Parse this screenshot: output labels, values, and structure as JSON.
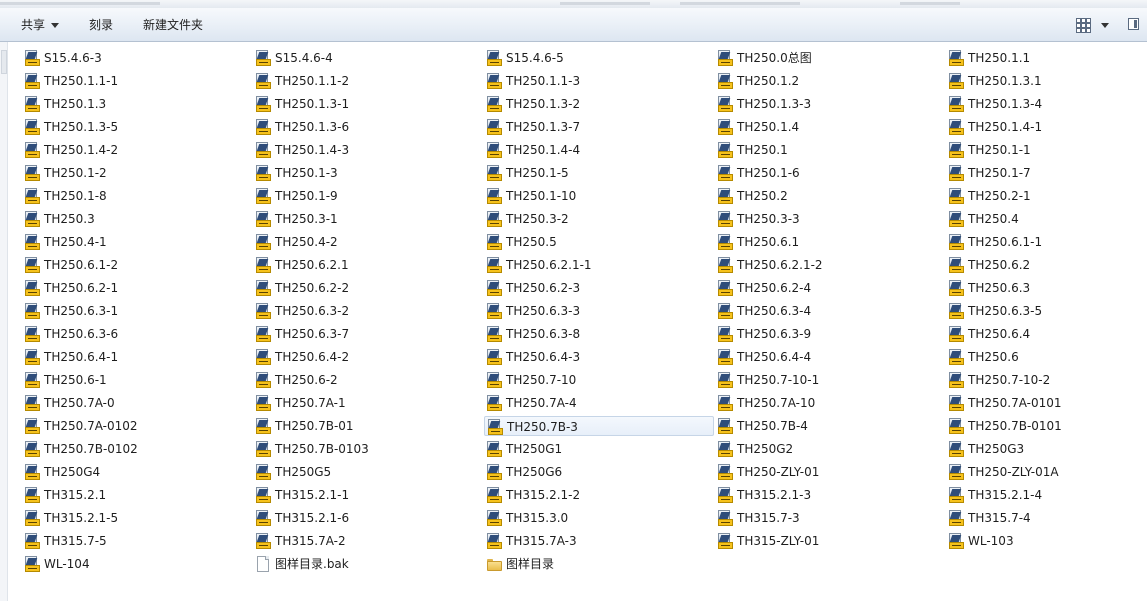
{
  "toolbar": {
    "share_label": "共享",
    "burn_label": "刻录",
    "new_folder_label": "新建文件夹"
  },
  "files": [
    {
      "name": "S15.4.6-3",
      "type": "dwg"
    },
    {
      "name": "S15.4.6-4",
      "type": "dwg"
    },
    {
      "name": "S15.4.6-5",
      "type": "dwg"
    },
    {
      "name": "TH250.0总图",
      "type": "dwg"
    },
    {
      "name": "TH250.1.1",
      "type": "dwg"
    },
    {
      "name": "TH250.1.1-1",
      "type": "dwg"
    },
    {
      "name": "TH250.1.1-2",
      "type": "dwg"
    },
    {
      "name": "TH250.1.1-3",
      "type": "dwg"
    },
    {
      "name": "TH250.1.2",
      "type": "dwg"
    },
    {
      "name": "TH250.1.3.1",
      "type": "dwg"
    },
    {
      "name": "TH250.1.3",
      "type": "dwg"
    },
    {
      "name": "TH250.1.3-1",
      "type": "dwg"
    },
    {
      "name": "TH250.1.3-2",
      "type": "dwg"
    },
    {
      "name": "TH250.1.3-3",
      "type": "dwg"
    },
    {
      "name": "TH250.1.3-4",
      "type": "dwg"
    },
    {
      "name": "TH250.1.3-5",
      "type": "dwg"
    },
    {
      "name": "TH250.1.3-6",
      "type": "dwg"
    },
    {
      "name": "TH250.1.3-7",
      "type": "dwg"
    },
    {
      "name": "TH250.1.4",
      "type": "dwg"
    },
    {
      "name": "TH250.1.4-1",
      "type": "dwg"
    },
    {
      "name": "TH250.1.4-2",
      "type": "dwg"
    },
    {
      "name": "TH250.1.4-3",
      "type": "dwg"
    },
    {
      "name": "TH250.1.4-4",
      "type": "dwg"
    },
    {
      "name": "TH250.1",
      "type": "dwg"
    },
    {
      "name": "TH250.1-1",
      "type": "dwg"
    },
    {
      "name": "TH250.1-2",
      "type": "dwg"
    },
    {
      "name": "TH250.1-3",
      "type": "dwg"
    },
    {
      "name": "TH250.1-5",
      "type": "dwg"
    },
    {
      "name": "TH250.1-6",
      "type": "dwg"
    },
    {
      "name": "TH250.1-7",
      "type": "dwg"
    },
    {
      "name": "TH250.1-8",
      "type": "dwg"
    },
    {
      "name": "TH250.1-9",
      "type": "dwg"
    },
    {
      "name": "TH250.1-10",
      "type": "dwg"
    },
    {
      "name": "TH250.2",
      "type": "dwg"
    },
    {
      "name": "TH250.2-1",
      "type": "dwg"
    },
    {
      "name": "TH250.3",
      "type": "dwg"
    },
    {
      "name": "TH250.3-1",
      "type": "dwg"
    },
    {
      "name": "TH250.3-2",
      "type": "dwg"
    },
    {
      "name": "TH250.3-3",
      "type": "dwg"
    },
    {
      "name": "TH250.4",
      "type": "dwg"
    },
    {
      "name": "TH250.4-1",
      "type": "dwg"
    },
    {
      "name": "TH250.4-2",
      "type": "dwg"
    },
    {
      "name": "TH250.5",
      "type": "dwg"
    },
    {
      "name": "TH250.6.1",
      "type": "dwg"
    },
    {
      "name": "TH250.6.1-1",
      "type": "dwg"
    },
    {
      "name": "TH250.6.1-2",
      "type": "dwg"
    },
    {
      "name": "TH250.6.2.1",
      "type": "dwg"
    },
    {
      "name": "TH250.6.2.1-1",
      "type": "dwg"
    },
    {
      "name": "TH250.6.2.1-2",
      "type": "dwg"
    },
    {
      "name": "TH250.6.2",
      "type": "dwg"
    },
    {
      "name": "TH250.6.2-1",
      "type": "dwg"
    },
    {
      "name": "TH250.6.2-2",
      "type": "dwg"
    },
    {
      "name": "TH250.6.2-3",
      "type": "dwg"
    },
    {
      "name": "TH250.6.2-4",
      "type": "dwg"
    },
    {
      "name": "TH250.6.3",
      "type": "dwg"
    },
    {
      "name": "TH250.6.3-1",
      "type": "dwg"
    },
    {
      "name": "TH250.6.3-2",
      "type": "dwg"
    },
    {
      "name": "TH250.6.3-3",
      "type": "dwg"
    },
    {
      "name": "TH250.6.3-4",
      "type": "dwg"
    },
    {
      "name": "TH250.6.3-5",
      "type": "dwg"
    },
    {
      "name": "TH250.6.3-6",
      "type": "dwg"
    },
    {
      "name": "TH250.6.3-7",
      "type": "dwg"
    },
    {
      "name": "TH250.6.3-8",
      "type": "dwg"
    },
    {
      "name": "TH250.6.3-9",
      "type": "dwg"
    },
    {
      "name": "TH250.6.4",
      "type": "dwg"
    },
    {
      "name": "TH250.6.4-1",
      "type": "dwg"
    },
    {
      "name": "TH250.6.4-2",
      "type": "dwg"
    },
    {
      "name": "TH250.6.4-3",
      "type": "dwg"
    },
    {
      "name": "TH250.6.4-4",
      "type": "dwg"
    },
    {
      "name": "TH250.6",
      "type": "dwg"
    },
    {
      "name": "TH250.6-1",
      "type": "dwg"
    },
    {
      "name": "TH250.6-2",
      "type": "dwg"
    },
    {
      "name": "TH250.7-10",
      "type": "dwg"
    },
    {
      "name": "TH250.7-10-1",
      "type": "dwg"
    },
    {
      "name": "TH250.7-10-2",
      "type": "dwg"
    },
    {
      "name": "TH250.7A-0",
      "type": "dwg"
    },
    {
      "name": "TH250.7A-1",
      "type": "dwg"
    },
    {
      "name": "TH250.7A-4",
      "type": "dwg"
    },
    {
      "name": "TH250.7A-10",
      "type": "dwg"
    },
    {
      "name": "TH250.7A-0101",
      "type": "dwg"
    },
    {
      "name": "TH250.7A-0102",
      "type": "dwg"
    },
    {
      "name": "TH250.7B-01",
      "type": "dwg"
    },
    {
      "name": "TH250.7B-3",
      "type": "dwg",
      "selected": true
    },
    {
      "name": "TH250.7B-4",
      "type": "dwg"
    },
    {
      "name": "TH250.7B-0101",
      "type": "dwg"
    },
    {
      "name": "TH250.7B-0102",
      "type": "dwg"
    },
    {
      "name": "TH250.7B-0103",
      "type": "dwg"
    },
    {
      "name": "TH250G1",
      "type": "dwg"
    },
    {
      "name": "TH250G2",
      "type": "dwg"
    },
    {
      "name": "TH250G3",
      "type": "dwg"
    },
    {
      "name": "TH250G4",
      "type": "dwg"
    },
    {
      "name": "TH250G5",
      "type": "dwg"
    },
    {
      "name": "TH250G6",
      "type": "dwg"
    },
    {
      "name": "TH250-ZLY-01",
      "type": "dwg"
    },
    {
      "name": "TH250-ZLY-01A",
      "type": "dwg"
    },
    {
      "name": "TH315.2.1",
      "type": "dwg"
    },
    {
      "name": "TH315.2.1-1",
      "type": "dwg"
    },
    {
      "name": "TH315.2.1-2",
      "type": "dwg"
    },
    {
      "name": "TH315.2.1-3",
      "type": "dwg"
    },
    {
      "name": "TH315.2.1-4",
      "type": "dwg"
    },
    {
      "name": "TH315.2.1-5",
      "type": "dwg"
    },
    {
      "name": "TH315.2.1-6",
      "type": "dwg"
    },
    {
      "name": "TH315.3.0",
      "type": "dwg"
    },
    {
      "name": "TH315.7-3",
      "type": "dwg"
    },
    {
      "name": "TH315.7-4",
      "type": "dwg"
    },
    {
      "name": "TH315.7-5",
      "type": "dwg"
    },
    {
      "name": "TH315.7A-2",
      "type": "dwg"
    },
    {
      "name": "TH315.7A-3",
      "type": "dwg"
    },
    {
      "name": "TH315-ZLY-01",
      "type": "dwg"
    },
    {
      "name": "WL-103",
      "type": "dwg"
    },
    {
      "name": "WL-104",
      "type": "dwg"
    },
    {
      "name": "图样目录.bak",
      "type": "bak"
    },
    {
      "name": "图样目录",
      "type": "folder"
    }
  ]
}
